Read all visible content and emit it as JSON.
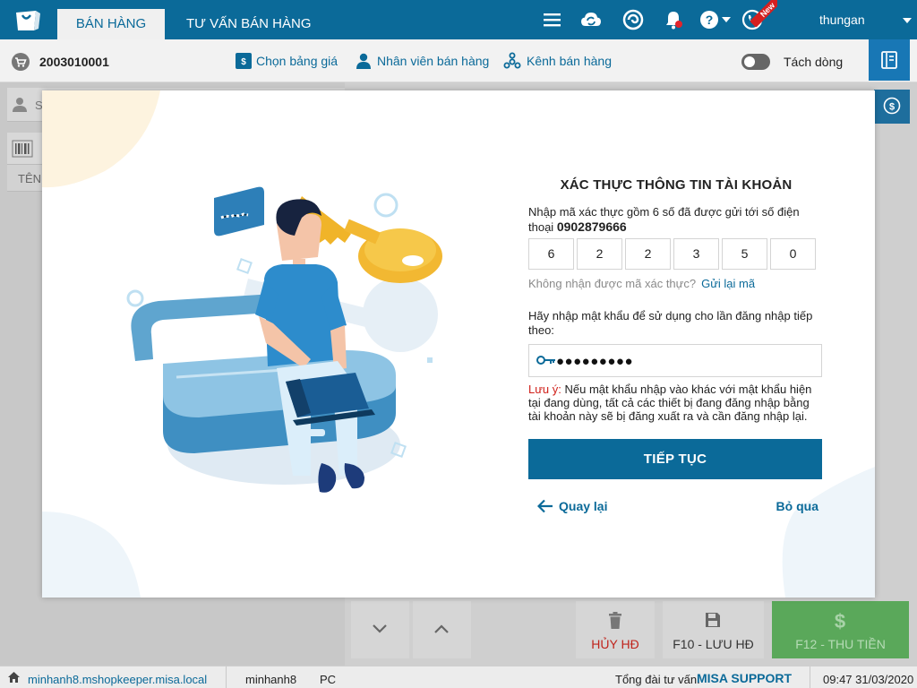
{
  "header": {
    "tabs": [
      {
        "label": "BÁN HÀNG"
      },
      {
        "label": "TƯ VẤN BÁN HÀNG"
      }
    ],
    "new_badge": "New",
    "user_name": "thungan"
  },
  "toolbar": {
    "order_number": "2003010001",
    "price_list": "Chọn bảng giá",
    "sales_staff": "Nhân viên bán hàng",
    "sales_channel": "Kênh bán hàng",
    "split_line": "Tách dòng"
  },
  "left_panel": {
    "customer_placeholder": "S",
    "column_name": "TÊN"
  },
  "bottom_actions": {
    "cancel": "HỦY HĐ",
    "save": "F10 - LƯU HĐ",
    "pay": "F12 - THU TIỀN"
  },
  "status_bar": {
    "domain": "minhanh8.mshopkeeper.misa.local",
    "user": "minhanh8",
    "device": "PC",
    "support_label": "Tổng đài tư vấn:",
    "support_name": "MISA SUPPORT",
    "datetime": "09:47 31/03/2020"
  },
  "modal": {
    "title": "XÁC THỰC THÔNG TIN TÀI KHOẢN",
    "instruction_prefix": "Nhập mã xác thực gồm 6 số đã được gửi tới số điện thoại ",
    "phone": "0902879666",
    "code_digits": [
      "6",
      "2",
      "2",
      "3",
      "5",
      "0"
    ],
    "resend_question": "Không nhận được mã xác thực?",
    "resend_link": "Gửi lại mã",
    "password_label": "Hãy nhập mật khẩu để sử dụng cho lần đăng nhập tiếp theo:",
    "password_value": "●●●●●●●●●",
    "note_label": "Lưu ý:",
    "note_text": " Nếu mật khẩu nhập vào khác với mật khẩu hiện tại đang dùng, tất cả các thiết bị đang đăng nhập bằng tài khoản này sẽ bị đăng xuất ra và cần đăng nhập lại.",
    "submit": "TIẾP TỤC",
    "back": "Quay lại",
    "skip": "Bỏ qua"
  },
  "colors": {
    "brand": "#0b6a99",
    "accent_red": "#d0201a",
    "pay_green": "#5aa85a"
  }
}
